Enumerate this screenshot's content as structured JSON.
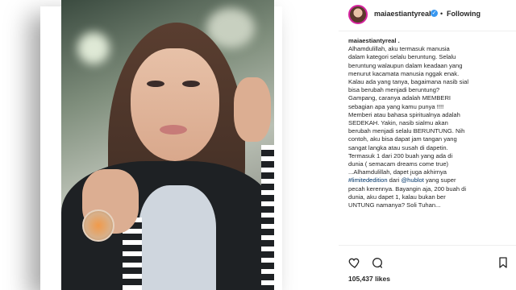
{
  "post": {
    "username": "maiaestiantyreal",
    "verified_icon": "verified-badge-icon",
    "separator": "•",
    "follow_label": "Following",
    "caption_user": "maiaestiantyreal .",
    "caption_lines": [
      "Alhamdulillah, aku termasuk manusia",
      "dalam kategori selalu beruntung. Selalu",
      "beruntung walaupun dalam keadaan yang",
      "menurut kacamata manusia nggak enak.",
      "Kalau ada yang tanya, bagaimana nasib sial",
      "bisa berubah menjadi beruntung?",
      "Gampang, caranya adalah MEMBERI",
      "sebagian apa yang kamu punya !!!!",
      "Memberi atau bahasa spiritualnya adalah",
      "SEDEKAH. Yakin, nasib sialmu akan",
      "berubah menjadi selalu BERUNTUNG. Nih",
      "contoh, aku bisa dapat jam tangan yang",
      "sangat langka atau susah di dapetin.",
      "Termasuk 1 dari 200 buah yang ada di",
      "dunia ( semacam dreams come true)",
      "...Alhamdulillah, dapet juga akhirnya"
    ],
    "caption_tail": {
      "tag1": "#limitededition",
      "mid1": " dari ",
      "tag2": "@hublot",
      "mid2": " yang super",
      "line3": "pecah kerennya. Bayangin aja, 200 buah di",
      "line4": "dunia, aku dapet 1, kalau bukan ber",
      "line5": "UNTUNG namanya? Soli Tuhan..."
    },
    "likes": "105,437 likes"
  },
  "icons": [
    "heart-icon",
    "comment-icon",
    "bookmark-icon"
  ],
  "colors": {
    "link": "#003569",
    "verified": "#3897f0",
    "text": "#262626"
  }
}
